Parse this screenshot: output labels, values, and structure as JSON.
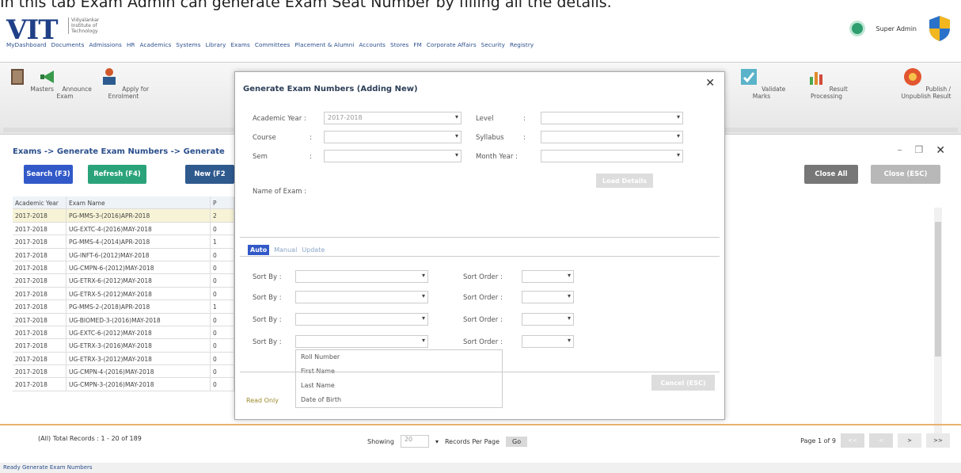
{
  "caption": "In this tab Exam Admin can generate Exam Seat Number by filling all the details.",
  "header": {
    "logo_text": "VIT",
    "logo_sub": "Vidyalankar Institute of Technology",
    "user": "Super Admin",
    "nav": [
      "MyDashboard",
      "Documents",
      "Admissions",
      "HR",
      "Academics",
      "Systems",
      "Library",
      "Exams",
      "Committees",
      "Placement & Alumni",
      "Accounts",
      "Stores",
      "FM",
      "Corporate Affairs",
      "Security",
      "Registry"
    ]
  },
  "toolbar": {
    "left": [
      {
        "label": "Masters",
        "icon": "book-icon"
      },
      {
        "label": "Announce Exam",
        "icon": "megaphone-icon"
      },
      {
        "label": "Apply for Enrolment",
        "icon": "apply-icon"
      }
    ],
    "right": [
      {
        "label": "Validate Marks",
        "icon": "validate-icon"
      },
      {
        "label": "Result Processing",
        "icon": "chart-icon"
      },
      {
        "label": "Publish / Unpublish Result",
        "icon": "publish-icon"
      }
    ]
  },
  "breadcrumb": "Exams -> Generate Exam Numbers -> Generate",
  "buttons": {
    "search": "Search (F3)",
    "refresh": "Refresh (F4)",
    "new": "New (F2",
    "close_all": "Close All",
    "close_esc": "Close (ESC)"
  },
  "grid": {
    "headers": [
      "Academic Year",
      "Exam Name",
      "P"
    ],
    "rows": [
      [
        "2017-2018",
        "PG-MMS-3-(2016)APR-2018",
        "2"
      ],
      [
        "2017-2018",
        "UG-EXTC-4-(2016)MAY-2018",
        "0"
      ],
      [
        "2017-2018",
        "PG-MMS-4-(2014)APR-2018",
        "1"
      ],
      [
        "2017-2018",
        "UG-INFT-6-(2012)MAY-2018",
        "0"
      ],
      [
        "2017-2018",
        "UG-CMPN-6-(2012)MAY-2018",
        "0"
      ],
      [
        "2017-2018",
        "UG-ETRX-6-(2012)MAY-2018",
        "0"
      ],
      [
        "2017-2018",
        "UG-ETRX-5-(2012)MAY-2018",
        "0"
      ],
      [
        "2017-2018",
        "PG-MMS-2-(2018)APR-2018",
        "1"
      ],
      [
        "2017-2018",
        "UG-BIOMED-3-(2016)MAY-2018",
        "0"
      ],
      [
        "2017-2018",
        "UG-EXTC-6-(2012)MAY-2018",
        "0"
      ],
      [
        "2017-2018",
        "UG-ETRX-3-(2016)MAY-2018",
        "0"
      ],
      [
        "2017-2018",
        "UG-ETRX-3-(2012)MAY-2018",
        "0"
      ],
      [
        "2017-2018",
        "UG-CMPN-4-(2016)MAY-2018",
        "0"
      ],
      [
        "2017-2018",
        "UG-CMPN-3-(2016)MAY-2018",
        "0"
      ]
    ]
  },
  "footer": {
    "total": "(All) Total Records : 1 - 20 of 189",
    "showing": "Showing",
    "per_page": "20",
    "records_per_page": "Records Per Page",
    "go": "Go",
    "page": "Page 1 of 9",
    "first": "<<",
    "prev": "<",
    "next": ">",
    "last": ">>"
  },
  "status": "Ready  Generate Exam Numbers",
  "modal": {
    "title": "Generate Exam Numbers (Adding New)",
    "academic_year_label": "Academic Year :",
    "academic_year_value": "2017-2018",
    "level_label": "Level",
    "course_label": "Course",
    "syllabus_label": "Syllabus",
    "sem_label": "Sem",
    "month_year_label": "Month Year :",
    "load_details": "Load Details",
    "name_of_exam_label": "Name of Exam :",
    "tabs": [
      "Auto",
      "Manual",
      "Update"
    ],
    "sort_by_label": "Sort By :",
    "sort_order_label": "Sort Order :",
    "dropdown_options": [
      "Roll Number",
      "First Name",
      "Last Name",
      "Date of Birth"
    ],
    "cancel": "Cancel (ESC)",
    "read_only": "Read Only"
  }
}
